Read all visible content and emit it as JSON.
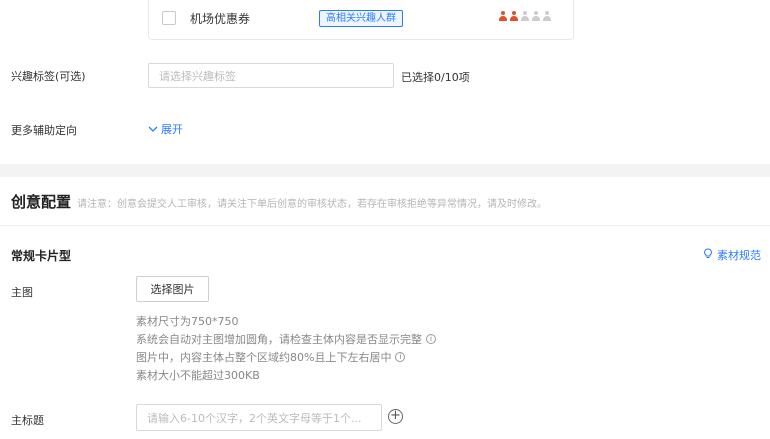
{
  "top_card": {
    "coupon_label": "机场优惠券",
    "tag_label": "高相关兴趣人群",
    "people_icons": [
      {
        "name": "person-filled-icon",
        "color": "#e0502a"
      },
      {
        "name": "person-filled-icon",
        "color": "#e0502a"
      },
      {
        "name": "person-empty-icon",
        "color": "#cccccc"
      },
      {
        "name": "person-empty-icon",
        "color": "#cccccc"
      },
      {
        "name": "person-empty-icon",
        "color": "#cccccc"
      }
    ]
  },
  "interest": {
    "label": "兴趣标签(可选)",
    "placeholder": "请选择兴趣标签",
    "count": "已选择0/10项"
  },
  "assist": {
    "label": "更多辅助定向",
    "expand_label": "展开",
    "expand_icon": "chevron-down-icon"
  },
  "creative": {
    "title": "创意配置",
    "note": "请注意：创意会提交人工审核，请关注下单后创意的审核状态，若存在审核拒绝等异常情况，请及时修改。"
  },
  "card_type": {
    "title": "常规卡片型",
    "spec_link": "素材规范",
    "spec_icon": "lightbulb-icon"
  },
  "main_image": {
    "label": "主图",
    "button_label": "选择图片",
    "hints": [
      {
        "text": "素材尺寸为750*750",
        "info": false
      },
      {
        "text": "系统会自动对主图增加圆角，请检查主体内容是否显示完整",
        "info": true
      },
      {
        "text": "图片中，内容主体占整个区域约80%且上下左右居中",
        "info": true
      },
      {
        "text": "素材大小不能超过300KB",
        "info": false
      }
    ]
  },
  "main_title": {
    "label": "主标题",
    "placeholder": "请输入6-10个汉字，2个英文字母等于1个..."
  },
  "colors": {
    "accent": "#2b7bff",
    "person_filled": "#e0502a",
    "person_empty": "#cccccc"
  }
}
